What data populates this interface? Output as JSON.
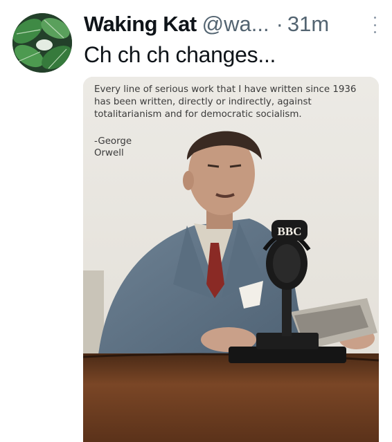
{
  "tweet": {
    "display_name": "Waking Kat",
    "handle": "@wa...",
    "separator": "·",
    "time": "31m",
    "text": "Ch ch ch changes..."
  },
  "avatar": {
    "icon": "leaf-plant-avatar",
    "color": "#2f5b2f"
  },
  "media": {
    "quote": "Every line of serious work that I have written since 1936 has been written, directly or indirectly, against totalitarianism and for democratic socialism.",
    "author_line1": "-George",
    "author_line2": "Orwell",
    "mic_label": "BBC"
  },
  "colors": {
    "text_primary": "#0f1419",
    "text_secondary": "#536471",
    "photo_background": "#e7e4df",
    "desk": "#6b3d20"
  }
}
